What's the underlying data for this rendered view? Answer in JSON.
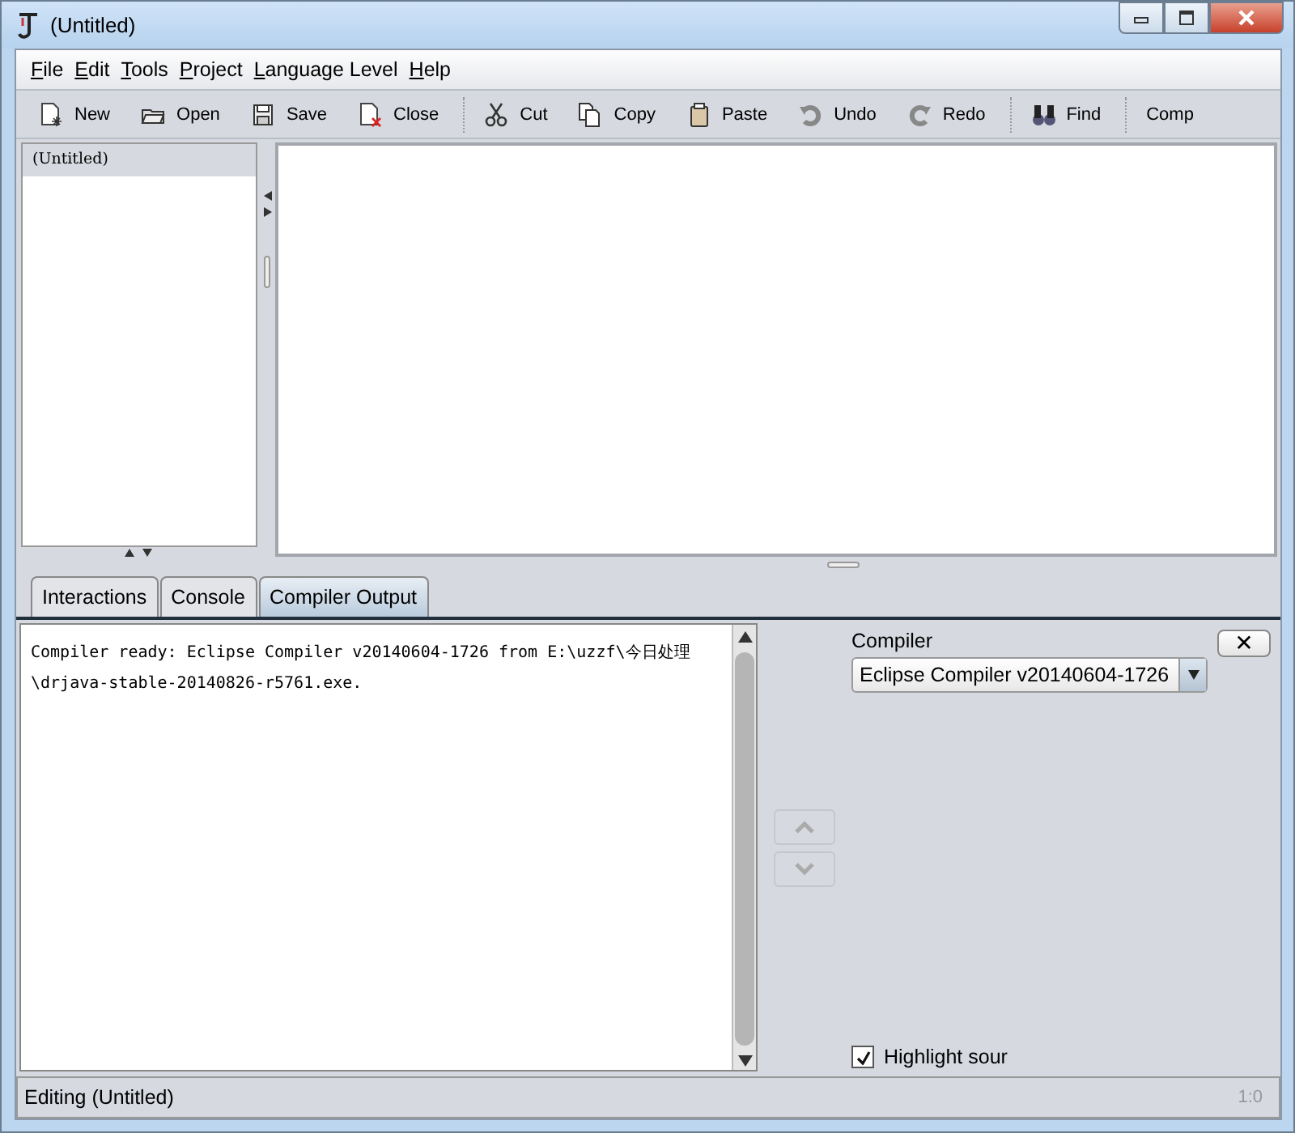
{
  "window": {
    "title": "(Untitled)"
  },
  "menu": [
    {
      "label": "File"
    },
    {
      "label": "Edit"
    },
    {
      "label": "Tools"
    },
    {
      "label": "Project"
    },
    {
      "label": "Language Level"
    },
    {
      "label": "Help"
    }
  ],
  "toolbar": [
    {
      "kind": "new",
      "label": "New"
    },
    {
      "kind": "open",
      "label": "Open"
    },
    {
      "kind": "save",
      "label": "Save"
    },
    {
      "kind": "close",
      "label": "Close"
    },
    {
      "kind": "separator"
    },
    {
      "kind": "cut",
      "label": "Cut"
    },
    {
      "kind": "copy",
      "label": "Copy"
    },
    {
      "kind": "paste",
      "label": "Paste"
    },
    {
      "kind": "undo",
      "label": "Undo"
    },
    {
      "kind": "redo",
      "label": "Redo"
    },
    {
      "kind": "separator"
    },
    {
      "kind": "find",
      "label": "Find"
    },
    {
      "kind": "separator"
    },
    {
      "kind": "text",
      "label": "Comp"
    }
  ],
  "documents": [
    {
      "label": "(Untitled)",
      "selected": true
    }
  ],
  "tabs": [
    {
      "label": "Interactions",
      "selected": false
    },
    {
      "label": "Console",
      "selected": false
    },
    {
      "label": "Compiler Output",
      "selected": true
    }
  ],
  "output": [
    "Compiler ready: Eclipse Compiler v20140604-1726 from E:\\uzzf\\今日处理",
    "\\drjava-stable-20140826-r5761.exe."
  ],
  "compiler": {
    "label": "Compiler",
    "value": "Eclipse Compiler v20140604-1726",
    "close": "✕"
  },
  "highlight": {
    "label": "Highlight sour",
    "checked": true
  },
  "status_bar": {
    "text": "Editing (Untitled)",
    "position": "1:0"
  }
}
